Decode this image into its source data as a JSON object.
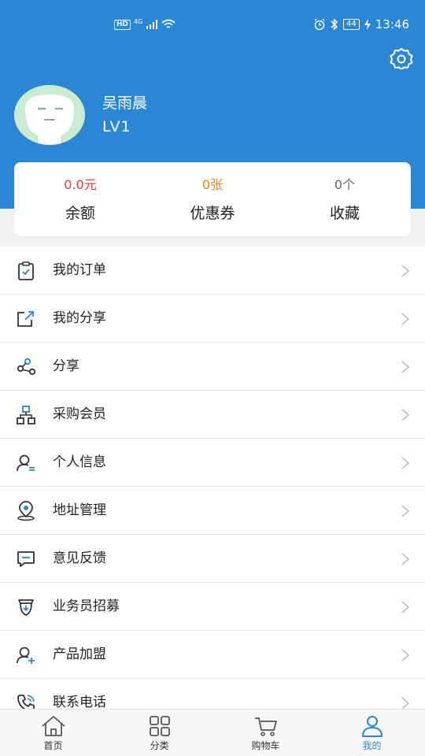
{
  "status_bar": {
    "network_hd": "HD",
    "network_4g": "4G",
    "battery": "44",
    "time": "13:46"
  },
  "header": {
    "settings_icon": "gear-icon",
    "username": "吴雨晨",
    "level": "LV1",
    "background_color": "#2b86d4"
  },
  "stats": [
    {
      "value": "0.0元",
      "label": "余额",
      "color": "#e53935"
    },
    {
      "value": "0张",
      "label": "优惠券",
      "color": "#f0821e"
    },
    {
      "value": "0个",
      "label": "收藏",
      "color": "#666666"
    }
  ],
  "menu": [
    {
      "label": "我的订单",
      "icon": "clipboard-check-icon"
    },
    {
      "label": "我的分享",
      "icon": "share-external-icon"
    },
    {
      "label": "分享",
      "icon": "share-nodes-icon"
    },
    {
      "label": "采购会员",
      "icon": "org-chart-icon"
    },
    {
      "label": "个人信息",
      "icon": "user-info-icon"
    },
    {
      "label": "地址管理",
      "icon": "location-pin-icon"
    },
    {
      "label": "意见反馈",
      "icon": "message-icon"
    },
    {
      "label": "业务员招募",
      "icon": "badge-icon"
    },
    {
      "label": "产品加盟",
      "icon": "user-add-icon"
    },
    {
      "label": "联系电话",
      "icon": "phone-icon"
    }
  ],
  "tabbar": {
    "tabs": [
      {
        "label": "首页",
        "icon": "home-icon"
      },
      {
        "label": "分类",
        "icon": "grid-icon"
      },
      {
        "label": "购物车",
        "icon": "cart-icon"
      },
      {
        "label": "我的",
        "icon": "user-icon"
      }
    ],
    "active_index": 3,
    "active_color": "#2b86d4"
  }
}
